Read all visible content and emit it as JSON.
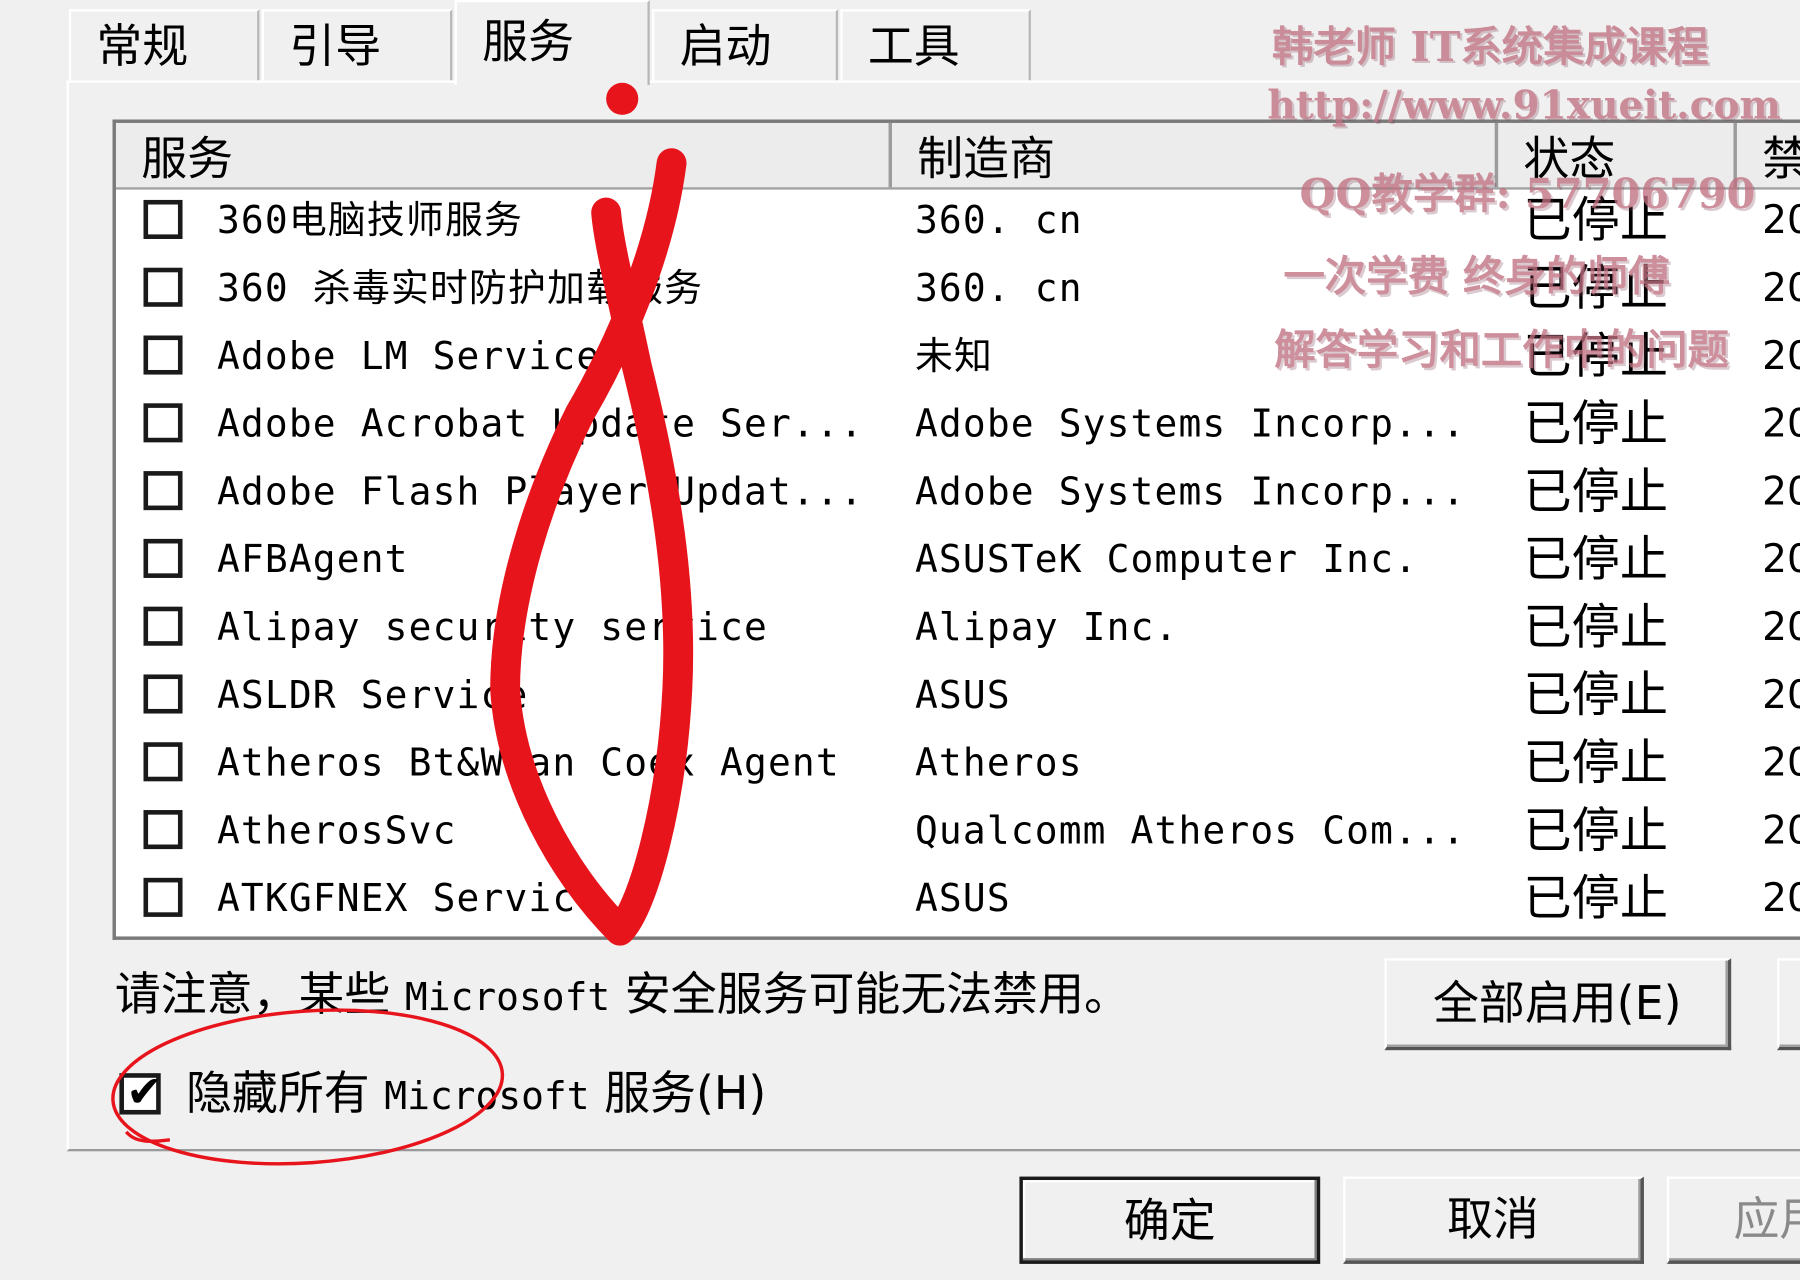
{
  "tabs": [
    {
      "label": "常规",
      "active": false
    },
    {
      "label": "引导",
      "active": false
    },
    {
      "label": "服务",
      "active": true
    },
    {
      "label": "启动",
      "active": false
    },
    {
      "label": "工具",
      "active": false
    }
  ],
  "list": {
    "columns": [
      "服务",
      "制造商",
      "状态",
      "禁"
    ],
    "rows": [
      {
        "name": "360电脑技师服务",
        "maker": "360. cn",
        "status": "已停止",
        "date": "20",
        "checked": false
      },
      {
        "name": "360 杀毒实时防护加载服务",
        "maker": "360. cn",
        "status": "已停止",
        "date": "20",
        "checked": false
      },
      {
        "name": "Adobe LM Service",
        "maker": "未知",
        "status": "已停止",
        "date": "20",
        "checked": false
      },
      {
        "name": "Adobe Acrobat Update Ser...",
        "maker": "Adobe Systems Incorp...",
        "status": "已停止",
        "date": "20",
        "checked": false
      },
      {
        "name": "Adobe Flash Player Updat...",
        "maker": "Adobe Systems Incorp...",
        "status": "已停止",
        "date": "20",
        "checked": false
      },
      {
        "name": "AFBAgent",
        "maker": "ASUSTeK Computer Inc.",
        "status": "已停止",
        "date": "20",
        "checked": false
      },
      {
        "name": "Alipay security service",
        "maker": "Alipay Inc.",
        "status": "已停止",
        "date": "20",
        "checked": false
      },
      {
        "name": "ASLDR Service",
        "maker": "ASUS",
        "status": "已停止",
        "date": "20",
        "checked": false
      },
      {
        "name": "Atheros Bt&Wlan Coex Agent",
        "maker": "Atheros",
        "status": "已停止",
        "date": "20",
        "checked": false
      },
      {
        "name": "AtherosSvc",
        "maker": "Qualcomm Atheros Com...",
        "status": "已停止",
        "date": "20",
        "checked": false
      },
      {
        "name": "ATKGFNEX Service",
        "maker": "ASUS",
        "status": "已停止",
        "date": "20",
        "checked": false
      }
    ]
  },
  "note": {
    "prefix": "请注意，某些 ",
    "mono": "Microsoft",
    "suffix": " 安全服务可能无法禁用。"
  },
  "hide_ms": {
    "checked": true,
    "check_mark": "✔",
    "prefix": "隐藏所有 ",
    "mono": "Microsoft",
    "suffix": " 服务(H)"
  },
  "buttons": {
    "enable_all": "全部启用(E)",
    "ok": "确定",
    "cancel": "取消",
    "apply": "应用"
  },
  "watermark": {
    "line1": "韩老师 IT系统集成课程",
    "line2": "http://www.91xueit.com",
    "line3": "QQ教学群: 57706790",
    "line4": "一次学费 终身的师傅",
    "line5": "解答学习和工作中的问题"
  },
  "colors": {
    "annotation_red": "#e8141c",
    "watermark": "#c07080",
    "panel": "#f0f0f0"
  }
}
